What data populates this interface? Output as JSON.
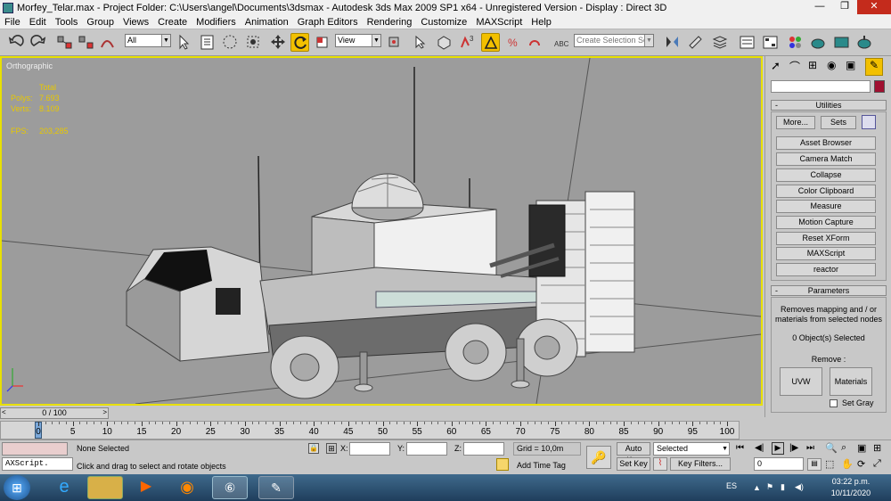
{
  "window": {
    "title": "Morfey_Telar.max  - Project Folder: C:\\Users\\angel\\Documents\\3dsmax     - Autodesk 3ds Max  2009 SP1  x64   - Unregistered Version     - Display : Direct 3D"
  },
  "menu": [
    "File",
    "Edit",
    "Tools",
    "Group",
    "Views",
    "Create",
    "Modifiers",
    "Animation",
    "Graph Editors",
    "Rendering",
    "Customize",
    "MAXScript",
    "Help"
  ],
  "toolbar": {
    "filter": "All",
    "coord": "View",
    "selection_set": "Create Selection Set"
  },
  "viewport": {
    "label": "Orthographic",
    "stats": {
      "total_label": "Total",
      "polys_label": "Polys:",
      "polys": "7.693",
      "verts_label": "Verts:",
      "verts": "8.109",
      "fps_label": "FPS:",
      "fps": "203,285"
    }
  },
  "command_panel": {
    "utilities_header": "Utilities",
    "more": "More...",
    "sets": "Sets",
    "buttons": [
      "Asset Browser",
      "Camera Match",
      "Collapse",
      "Color Clipboard",
      "Measure",
      "Motion Capture",
      "Reset XForm",
      "MAXScript",
      "reactor"
    ],
    "parameters_header": "Parameters",
    "parameters_text": "Removes mapping and / or materials from selected nodes",
    "selected": "0 Object(s) Selected",
    "remove_label": "Remove :",
    "uvw": "UVW",
    "materials": "Materials",
    "set_gray": "Set Gray"
  },
  "timeline": {
    "frame": "0 / 100",
    "ticks": [
      "0",
      "5",
      "10",
      "15",
      "20",
      "25",
      "30",
      "35",
      "40",
      "45",
      "50",
      "55",
      "60",
      "65",
      "70",
      "75",
      "80",
      "85",
      "90",
      "95",
      "100"
    ]
  },
  "status": {
    "maxscript": "AXScript.",
    "selection": "None Selected",
    "prompt": "Click and drag to select and rotate objects",
    "x_label": "X:",
    "y_label": "Y:",
    "z_label": "Z:",
    "grid": "Grid = 10,0m",
    "add_time_tag": "Add Time Tag",
    "auto_key": "Auto Key",
    "set_key": "Set Key",
    "key_mode": "Selected",
    "key_filters": "Key Filters...",
    "current_frame": "0"
  },
  "taskbar": {
    "lang": "ES",
    "time": "03:22 p.m.",
    "date": "10/11/2020"
  },
  "colors": {
    "accent": "#e8e000",
    "viewport_bg": "#9c9c9c"
  }
}
